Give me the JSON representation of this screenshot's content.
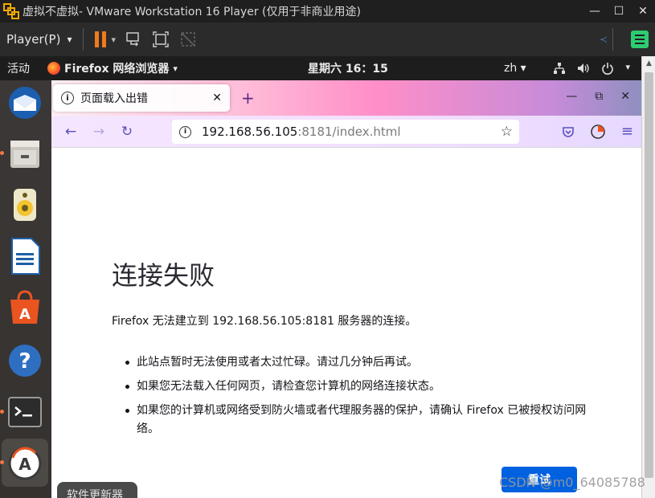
{
  "vmware": {
    "title": "虚拟不虚拟- VMware Workstation 16 Player (仅用于非商业用途)",
    "player_menu": "Player(P)",
    "player_arrow": "▾",
    "window_buttons": [
      "—",
      "☐",
      "✕"
    ]
  },
  "ubuntu_topbar": {
    "activities": "活动",
    "app_name": "Firefox 网络浏览器",
    "app_arrow": "▾",
    "clock": "星期六 16：15",
    "ime": "zh ▾",
    "tray": [
      "network-icon",
      "volume-icon",
      "power-icon"
    ]
  },
  "dock": {
    "items": [
      "thunderbird-icon",
      "files-icon",
      "rhythmbox-icon",
      "writer-icon",
      "software-icon",
      "help-icon",
      "terminal-icon",
      "software-updater-icon"
    ],
    "tooltip": "软件更新器"
  },
  "firefox": {
    "tab_title": "页面载入出错",
    "tab_close": "✕",
    "new_tab": "+",
    "url_host": "192.168.56.105",
    "url_rest": ":8181/index.html"
  },
  "error_page": {
    "title": "连接失败",
    "description": "Firefox 无法建立到 192.168.56.105:8181 服务器的连接。",
    "bullets": [
      "此站点暂时无法使用或者太过忙碌。请过几分钟后再试。",
      "如果您无法载入任何网页，请检查您计算机的网络连接状态。",
      "如果您的计算机或网络受到防火墙或者代理服务器的保护，请确认 Firefox 已被授权访问网络。"
    ],
    "retry_label": "重试"
  },
  "watermark": "CSDN @m0_64085788",
  "colors": {
    "accent_orange": "#f27a1a",
    "retry_blue": "#0061e0",
    "ff_purple": "#5b4fbe"
  }
}
